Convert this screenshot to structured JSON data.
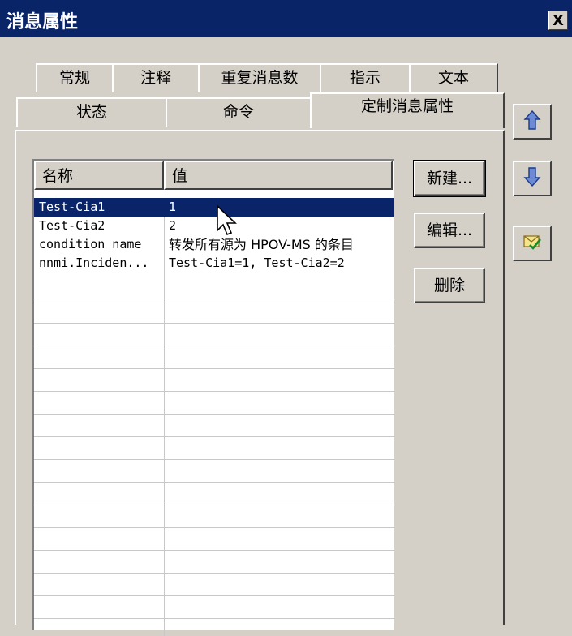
{
  "window": {
    "title": "消息属性",
    "close_label": "X"
  },
  "tabs": {
    "row1": [
      "常规",
      "注释",
      "重复消息数",
      "指示",
      "文本"
    ],
    "row2": [
      "状态",
      "命令",
      "定制消息属性"
    ],
    "active": "定制消息属性"
  },
  "list": {
    "headers": [
      "名称",
      "值"
    ],
    "rows": [
      {
        "name": "Test-Cia1",
        "value": "1",
        "selected": true
      },
      {
        "name": "Test-Cia2",
        "value": "2",
        "selected": false
      },
      {
        "name": "condition_name",
        "value": "转发所有源为 HPOV-MS 的条目",
        "selected": false
      },
      {
        "name": "nnmi.Inciden...",
        "value": "Test-Cia1=1, Test-Cia2=2",
        "selected": false
      }
    ]
  },
  "buttons": {
    "new": "新建...",
    "edit": "编辑...",
    "delete": "删除"
  },
  "side_buttons": [
    "arrow-up-icon",
    "arrow-down-icon",
    "checkmark-envelope-icon"
  ]
}
